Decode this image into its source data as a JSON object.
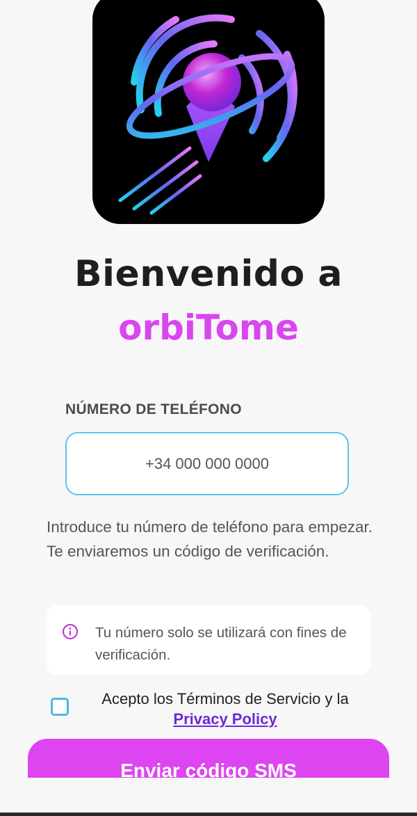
{
  "logo": {
    "icon": "orbit-location-pin-logo"
  },
  "welcome": {
    "title": "Bienvenido a",
    "brand": "orbiTome"
  },
  "phone": {
    "label": "NÚMERO DE TELÉFONO",
    "placeholder": "+34 000 000 0000",
    "value": ""
  },
  "helper_text": "Introduce tu número de teléfono para empezar. Te enviaremos un código de verificación.",
  "info": {
    "icon": "info-icon",
    "text": "Tu número solo se utilizará con fines de verificación."
  },
  "terms": {
    "checked": false,
    "text": "Acepto los Términos de Servicio y la",
    "link": "Privacy Policy"
  },
  "button": {
    "label": "Enviar código SMS"
  },
  "colors": {
    "brand": "#d946ef",
    "button": "#dd45f0",
    "input_border": "#5ec3ea",
    "link": "#6d28d9"
  }
}
